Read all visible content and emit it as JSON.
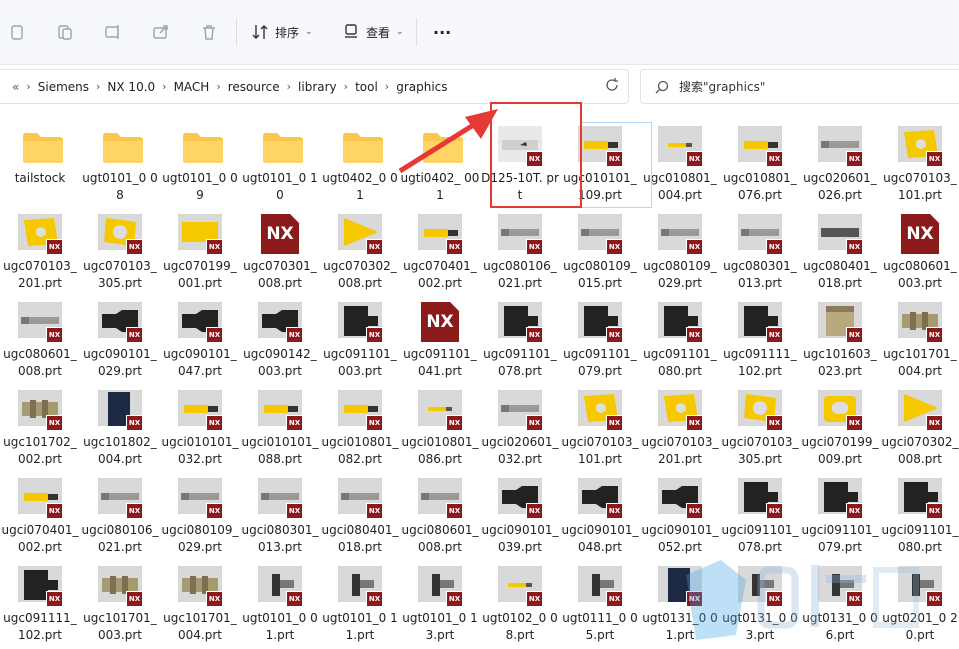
{
  "toolbar": {
    "sort_label": "排序",
    "view_label": "查看",
    "more_label": "···"
  },
  "breadcrumb": {
    "overflow": "«",
    "items": [
      "Siemens",
      "NX 10.0",
      "MACH",
      "resource",
      "library",
      "tool",
      "graphics"
    ]
  },
  "search": {
    "placeholder": "搜索\"graphics\""
  },
  "files": [
    [
      "tailstock",
      "ugt0101_0 08",
      "ugt0101_0 09",
      "ugt0101_0 10",
      "ugt0402_0 01",
      "ugti0402_ 001",
      "D125-10T. prt",
      "ugc010101_ 109.prt",
      "ugc010801_ 004.prt",
      "ugc010801_ 076.prt",
      "ugc020601_ 026.prt",
      "ugc070103_ 101.prt"
    ],
    [
      "ugc070103_ 201.prt",
      "ugc070103_ 305.prt",
      "ugc070199_ 001.prt",
      "ugc070301_ 008.prt",
      "ugc070302_ 008.prt",
      "ugc070401_ 002.prt",
      "ugc080106_ 021.prt",
      "ugc080109_ 015.prt",
      "ugc080109_ 029.prt",
      "ugc080301_ 013.prt",
      "ugc080401_ 018.prt",
      "ugc080601_ 003.prt"
    ],
    [
      "ugc080601_ 008.prt",
      "ugc090101_ 029.prt",
      "ugc090101_ 047.prt",
      "ugc090142_ 003.prt",
      "ugc091101_ 003.prt",
      "ugc091101_ 041.prt",
      "ugc091101_ 078.prt",
      "ugc091101_ 079.prt",
      "ugc091101_ 080.prt",
      "ugc091111_ 102.prt",
      "ugc101603_ 023.prt",
      "ugc101701_ 004.prt"
    ],
    [
      "ugc101702_ 002.prt",
      "ugc101802_ 004.prt",
      "ugci010101_ 032.prt",
      "ugci010101_ 088.prt",
      "ugci010801_ 082.prt",
      "ugci010801_ 086.prt",
      "ugci020601_ 032.prt",
      "ugci070103_ 101.prt",
      "ugci070103_ 201.prt",
      "ugci070103_ 305.prt",
      "ugci070199_ 009.prt",
      "ugci070302_ 008.prt"
    ],
    [
      "ugci070401_ 002.prt",
      "ugci080106_ 021.prt",
      "ugci080109_ 029.prt",
      "ugci080301_ 013.prt",
      "ugci080401_ 018.prt",
      "ugci080601_ 008.prt",
      "ugci090101_ 039.prt",
      "ugci090101_ 048.prt",
      "ugci090101_ 052.prt",
      "ugci091101_ 078.prt",
      "ugci091101_ 079.prt",
      "ugci091101_ 080.prt"
    ],
    [
      "ugc091111_ 102.prt",
      "ugc101701_ 003.prt",
      "ugc101701_ 004.prt",
      "ugt0101_0 01.prt",
      "ugt0101_0 11.prt",
      "ugt0101_0 13.prt",
      "ugt0102_0 08.prt",
      "ugt0111_0 05.prt",
      "ugt0131_0 01.prt",
      "ugt0131_0 03.prt",
      "ugt0131_0 06.prt",
      "ugt0201_0 20.prt"
    ]
  ],
  "badge_text": "NX",
  "colors": {
    "accent": "#e53935",
    "folder": "#f8c74b",
    "nx": "#8b1a1a",
    "insert": "#f5c800"
  }
}
